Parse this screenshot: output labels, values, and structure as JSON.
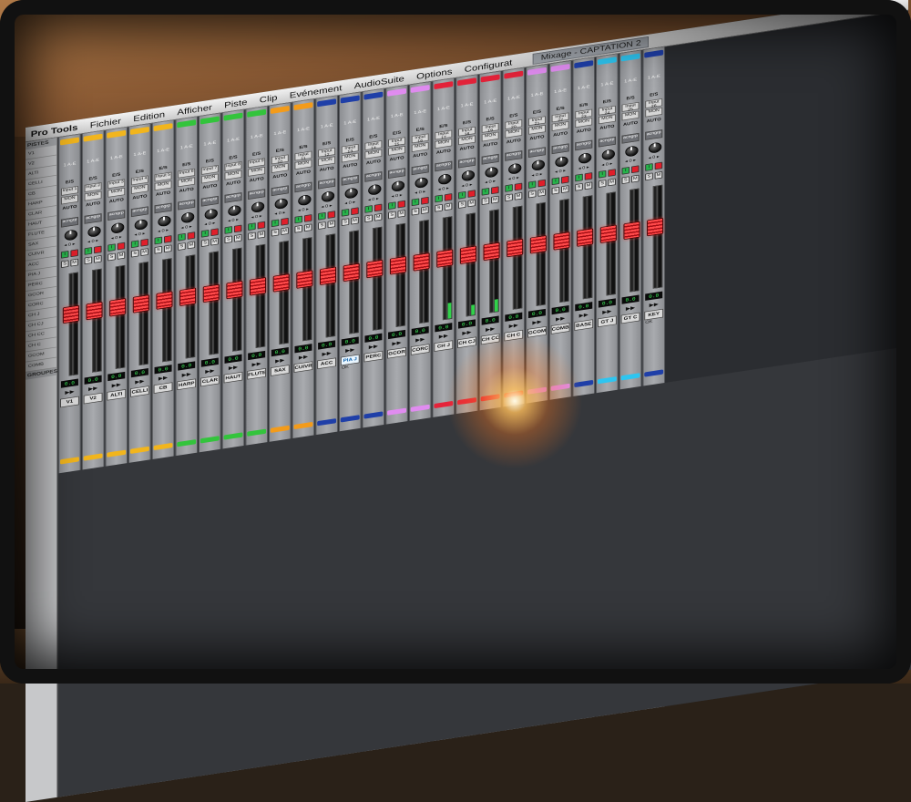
{
  "menubar": {
    "app": "Pro Tools",
    "items": [
      "Fichier",
      "Edition",
      "Afficher",
      "Piste",
      "Clip",
      "Evénement",
      "AudioSuite",
      "Options",
      "Configurat"
    ],
    "window_title": "Mixage - CAPTATION 2"
  },
  "left_panel": {
    "tracks_header": "PISTES",
    "groups_header": "GROUPES",
    "rows": [
      "V1",
      "V2",
      "ALTI",
      "CELLI",
      "CB",
      "HARP",
      "CLAR",
      "HAUT",
      "FLUTE",
      "SAX",
      "CUIVR",
      "ACC",
      "PIA J",
      "PERC",
      "GCOR",
      "CORC",
      "CH J",
      "CH CJ",
      "CH CC",
      "CH C",
      "GCOM",
      "COMB"
    ]
  },
  "strip_labels": {
    "es": "E/S",
    "monitor": "MON",
    "auto": "AUTO",
    "group": "acngrp",
    "pan": "◂ 0 ▸",
    "solo": "S",
    "mute": "M",
    "input": "I",
    "play": "▶▶"
  },
  "colors": {
    "yellow": "#f2b51d",
    "green": "#33c43c",
    "orange": "#f39b1a",
    "blue": "#1f3fa8",
    "lilac": "#e08cf0",
    "red": "#e5233a",
    "cyan": "#2ec5f0"
  },
  "channels": [
    {
      "name": "V1",
      "io": "1 A-E",
      "input": "Input 1",
      "volume": "0.0",
      "color": "yellow",
      "fader": 0.62,
      "meter": 0.0
    },
    {
      "name": "V2",
      "io": "1 A-E",
      "input": "Input 2",
      "volume": "0.0",
      "color": "yellow",
      "fader": 0.62,
      "meter": 0.0
    },
    {
      "name": "ALTI",
      "io": "1 A-E",
      "input": "Input 3",
      "volume": "0.0",
      "color": "yellow",
      "fader": 0.62,
      "meter": 0.0
    },
    {
      "name": "CELLI",
      "io": "1 A-E",
      "input": "Input 4",
      "volume": "0.0",
      "color": "yellow",
      "fader": 0.62,
      "meter": 0.0
    },
    {
      "name": "CB",
      "io": "1 A-E",
      "input": "Input 5",
      "volume": "0.0",
      "color": "yellow",
      "fader": 0.62,
      "meter": 0.0
    },
    {
      "name": "HARP",
      "io": "1 A-E",
      "input": "Input 6",
      "volume": "0.0",
      "color": "green",
      "fader": 0.62,
      "meter": 0.0
    },
    {
      "name": "CLAR",
      "io": "1 A-E",
      "input": "Input 7",
      "volume": "0.0",
      "color": "green",
      "fader": 0.62,
      "meter": 0.0
    },
    {
      "name": "HAUT",
      "io": "1 A-E",
      "input": "Input 8",
      "volume": "0.0",
      "color": "green",
      "fader": 0.62,
      "meter": 0.0
    },
    {
      "name": "FLUTE",
      "io": "1 A-E",
      "input": "Input 9",
      "volume": "0.0",
      "color": "green",
      "fader": 0.62,
      "meter": 0.0
    },
    {
      "name": "SAX",
      "io": "1 A-E",
      "input": "Input 10",
      "volume": "0.0",
      "color": "orange",
      "fader": 0.62,
      "meter": 0.0
    },
    {
      "name": "CUIVR",
      "io": "1 A-E",
      "input": "Input 11",
      "volume": "0.0",
      "color": "orange",
      "fader": 0.62,
      "meter": 0.0
    },
    {
      "name": "ACC",
      "io": "1 A-E",
      "input": "Input 12",
      "volume": "0.0",
      "color": "blue",
      "fader": 0.62,
      "meter": 0.0
    },
    {
      "name": "PIA J",
      "io": "1 A-E",
      "input": "Input 13",
      "volume": "0.0",
      "color": "blue",
      "fader": 0.62,
      "meter": 0.0,
      "selected": true,
      "comment": "OK"
    },
    {
      "name": "PERC",
      "io": "1 A-E",
      "input": "Input 14",
      "volume": "0.0",
      "color": "blue",
      "fader": 0.62,
      "meter": 0.0
    },
    {
      "name": "GCOR",
      "io": "1 A-E",
      "input": "Input 15",
      "volume": "0.0",
      "color": "lilac",
      "fader": 0.62,
      "meter": 0.0
    },
    {
      "name": "CORC",
      "io": "1 A-E",
      "input": "Input 16",
      "volume": "0.0",
      "color": "lilac",
      "fader": 0.62,
      "meter": 0.0
    },
    {
      "name": "CH J",
      "io": "1 A-E",
      "input": "Input 17",
      "volume": "0.0",
      "color": "red",
      "fader": 0.62,
      "meter": 0.15
    },
    {
      "name": "CH CJ",
      "io": "1 A-E",
      "input": "Input 18",
      "volume": "0.0",
      "color": "red",
      "fader": 0.62,
      "meter": 0.1
    },
    {
      "name": "CH CC",
      "io": "1 A-E",
      "input": "Input 19",
      "volume": "0.0",
      "color": "red",
      "fader": 0.62,
      "meter": 0.12
    },
    {
      "name": "CH C",
      "io": "1 A-E",
      "input": "Input 20",
      "volume": "0.0",
      "color": "red",
      "fader": 0.62,
      "meter": 0.0
    },
    {
      "name": "GCOM",
      "io": "1 A-E",
      "input": "Input 21",
      "volume": "0.0",
      "color": "lilac",
      "fader": 0.62,
      "meter": 0.0
    },
    {
      "name": "COMB",
      "io": "1 A-E",
      "input": "Input 22",
      "volume": "0.0",
      "color": "lilac",
      "fader": 0.62,
      "meter": 0.0
    },
    {
      "name": "BASE",
      "io": "1 A-E",
      "input": "Input 23",
      "volume": "0.0",
      "color": "blue",
      "fader": 0.62,
      "meter": 0.0
    },
    {
      "name": "GT J",
      "io": "1 A-E",
      "input": "Input 24",
      "volume": "0.0",
      "color": "cyan",
      "fader": 0.62,
      "meter": 0.0
    },
    {
      "name": "GT C",
      "io": "1 A-E",
      "input": "Input 25",
      "volume": "0.0",
      "color": "cyan",
      "fader": 0.62,
      "meter": 0.0
    },
    {
      "name": "KEY",
      "io": "1 A-E",
      "input": "Input 26",
      "volume": "0.0",
      "color": "blue",
      "fader": 0.62,
      "meter": 0.0,
      "comment": "OK"
    }
  ]
}
